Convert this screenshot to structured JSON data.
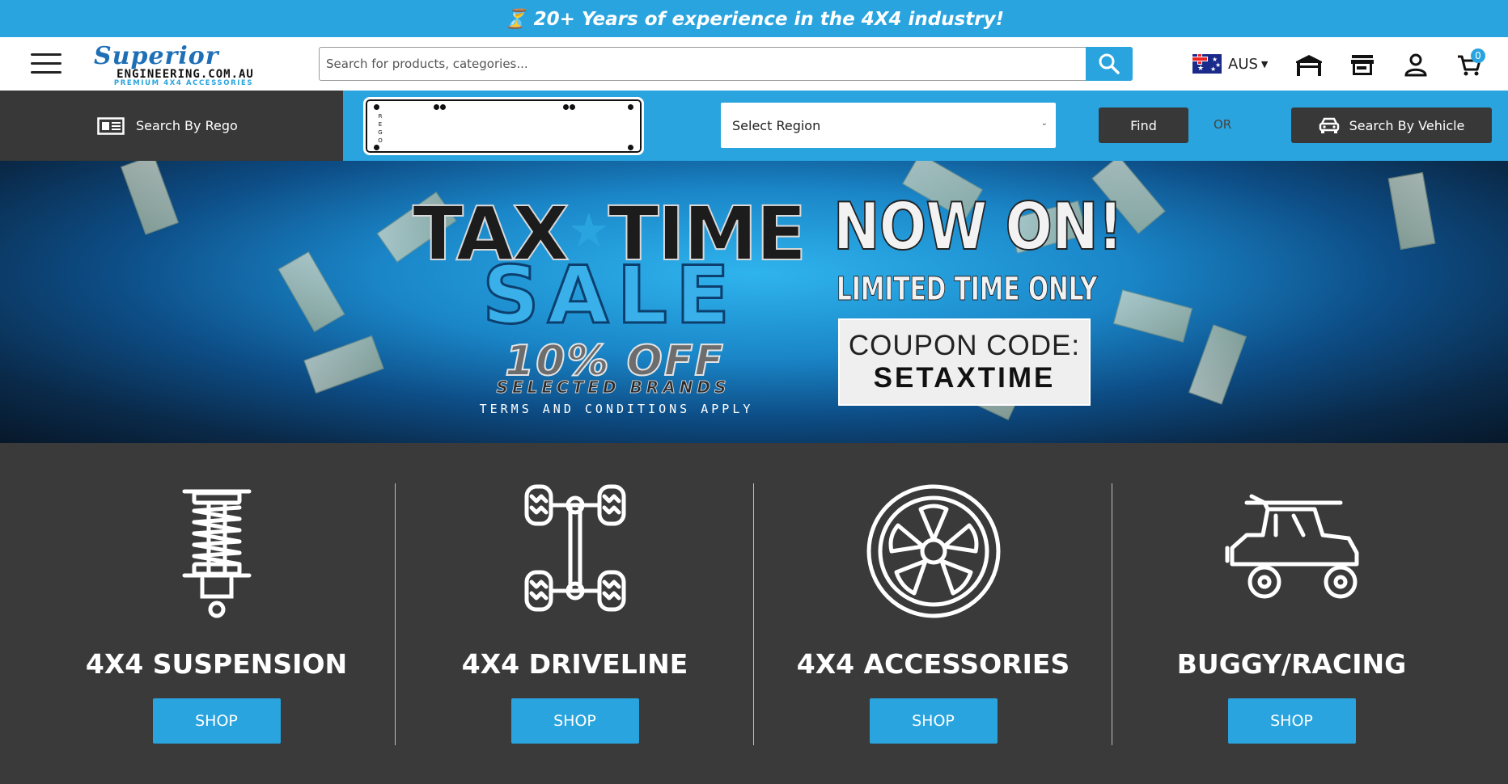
{
  "announcement": {
    "icon": "hourglass-icon",
    "text": "⏳ 20+ Years of experience in the 4X4 industry!"
  },
  "header": {
    "logo": {
      "line1": "Superior",
      "line2": "ENGINEERING.COM.AU",
      "line3": "PREMIUM 4X4 ACCESSORIES"
    },
    "search": {
      "placeholder": "Search for products, categories..."
    },
    "country": {
      "code": "AUS"
    },
    "cart": {
      "count": "0"
    }
  },
  "rego": {
    "label": "Search By Rego",
    "plate_text": "REGO",
    "region": {
      "selected": "Select Region"
    },
    "find_label": "Find",
    "or_label": "OR",
    "vehicle_label": "Search By Vehicle"
  },
  "hero": {
    "title_left": "TAX",
    "title_right": "TIME",
    "sale": "SALE",
    "discount": "10% OFF",
    "brands": "SELECTED BRANDS",
    "terms": "TERMS AND CONDITIONS APPLY",
    "now_on": "NOW ON!",
    "limited": "LIMITED TIME ONLY",
    "coupon_label": "COUPON CODE:",
    "coupon_code": "SETAXTIME"
  },
  "categories": [
    {
      "title": "4X4 SUSPENSION",
      "button": "SHOP",
      "icon": "coilover-icon"
    },
    {
      "title": "4X4 DRIVELINE",
      "button": "SHOP",
      "icon": "driveline-icon"
    },
    {
      "title": "4X4 ACCESSORIES",
      "button": "SHOP",
      "icon": "wheel-icon"
    },
    {
      "title": "BUGGY/RACING",
      "button": "SHOP",
      "icon": "buggy-icon"
    }
  ],
  "colors": {
    "accent": "#29a4de",
    "dark": "#383838",
    "bg": "#3a3a3a"
  }
}
